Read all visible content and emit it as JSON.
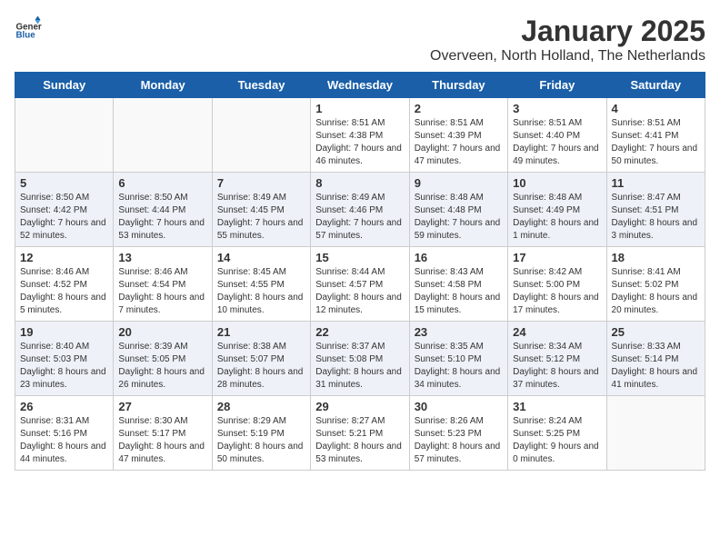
{
  "header": {
    "logo_general": "General",
    "logo_blue": "Blue",
    "month_title": "January 2025",
    "location": "Overveen, North Holland, The Netherlands"
  },
  "weekdays": [
    "Sunday",
    "Monday",
    "Tuesday",
    "Wednesday",
    "Thursday",
    "Friday",
    "Saturday"
  ],
  "rows": [
    [
      {
        "day": "",
        "info": ""
      },
      {
        "day": "",
        "info": ""
      },
      {
        "day": "",
        "info": ""
      },
      {
        "day": "1",
        "info": "Sunrise: 8:51 AM\nSunset: 4:38 PM\nDaylight: 7 hours and 46 minutes."
      },
      {
        "day": "2",
        "info": "Sunrise: 8:51 AM\nSunset: 4:39 PM\nDaylight: 7 hours and 47 minutes."
      },
      {
        "day": "3",
        "info": "Sunrise: 8:51 AM\nSunset: 4:40 PM\nDaylight: 7 hours and 49 minutes."
      },
      {
        "day": "4",
        "info": "Sunrise: 8:51 AM\nSunset: 4:41 PM\nDaylight: 7 hours and 50 minutes."
      }
    ],
    [
      {
        "day": "5",
        "info": "Sunrise: 8:50 AM\nSunset: 4:42 PM\nDaylight: 7 hours and 52 minutes."
      },
      {
        "day": "6",
        "info": "Sunrise: 8:50 AM\nSunset: 4:44 PM\nDaylight: 7 hours and 53 minutes."
      },
      {
        "day": "7",
        "info": "Sunrise: 8:49 AM\nSunset: 4:45 PM\nDaylight: 7 hours and 55 minutes."
      },
      {
        "day": "8",
        "info": "Sunrise: 8:49 AM\nSunset: 4:46 PM\nDaylight: 7 hours and 57 minutes."
      },
      {
        "day": "9",
        "info": "Sunrise: 8:48 AM\nSunset: 4:48 PM\nDaylight: 7 hours and 59 minutes."
      },
      {
        "day": "10",
        "info": "Sunrise: 8:48 AM\nSunset: 4:49 PM\nDaylight: 8 hours and 1 minute."
      },
      {
        "day": "11",
        "info": "Sunrise: 8:47 AM\nSunset: 4:51 PM\nDaylight: 8 hours and 3 minutes."
      }
    ],
    [
      {
        "day": "12",
        "info": "Sunrise: 8:46 AM\nSunset: 4:52 PM\nDaylight: 8 hours and 5 minutes."
      },
      {
        "day": "13",
        "info": "Sunrise: 8:46 AM\nSunset: 4:54 PM\nDaylight: 8 hours and 7 minutes."
      },
      {
        "day": "14",
        "info": "Sunrise: 8:45 AM\nSunset: 4:55 PM\nDaylight: 8 hours and 10 minutes."
      },
      {
        "day": "15",
        "info": "Sunrise: 8:44 AM\nSunset: 4:57 PM\nDaylight: 8 hours and 12 minutes."
      },
      {
        "day": "16",
        "info": "Sunrise: 8:43 AM\nSunset: 4:58 PM\nDaylight: 8 hours and 15 minutes."
      },
      {
        "day": "17",
        "info": "Sunrise: 8:42 AM\nSunset: 5:00 PM\nDaylight: 8 hours and 17 minutes."
      },
      {
        "day": "18",
        "info": "Sunrise: 8:41 AM\nSunset: 5:02 PM\nDaylight: 8 hours and 20 minutes."
      }
    ],
    [
      {
        "day": "19",
        "info": "Sunrise: 8:40 AM\nSunset: 5:03 PM\nDaylight: 8 hours and 23 minutes."
      },
      {
        "day": "20",
        "info": "Sunrise: 8:39 AM\nSunset: 5:05 PM\nDaylight: 8 hours and 26 minutes."
      },
      {
        "day": "21",
        "info": "Sunrise: 8:38 AM\nSunset: 5:07 PM\nDaylight: 8 hours and 28 minutes."
      },
      {
        "day": "22",
        "info": "Sunrise: 8:37 AM\nSunset: 5:08 PM\nDaylight: 8 hours and 31 minutes."
      },
      {
        "day": "23",
        "info": "Sunrise: 8:35 AM\nSunset: 5:10 PM\nDaylight: 8 hours and 34 minutes."
      },
      {
        "day": "24",
        "info": "Sunrise: 8:34 AM\nSunset: 5:12 PM\nDaylight: 8 hours and 37 minutes."
      },
      {
        "day": "25",
        "info": "Sunrise: 8:33 AM\nSunset: 5:14 PM\nDaylight: 8 hours and 41 minutes."
      }
    ],
    [
      {
        "day": "26",
        "info": "Sunrise: 8:31 AM\nSunset: 5:16 PM\nDaylight: 8 hours and 44 minutes."
      },
      {
        "day": "27",
        "info": "Sunrise: 8:30 AM\nSunset: 5:17 PM\nDaylight: 8 hours and 47 minutes."
      },
      {
        "day": "28",
        "info": "Sunrise: 8:29 AM\nSunset: 5:19 PM\nDaylight: 8 hours and 50 minutes."
      },
      {
        "day": "29",
        "info": "Sunrise: 8:27 AM\nSunset: 5:21 PM\nDaylight: 8 hours and 53 minutes."
      },
      {
        "day": "30",
        "info": "Sunrise: 8:26 AM\nSunset: 5:23 PM\nDaylight: 8 hours and 57 minutes."
      },
      {
        "day": "31",
        "info": "Sunrise: 8:24 AM\nSunset: 5:25 PM\nDaylight: 9 hours and 0 minutes."
      },
      {
        "day": "",
        "info": ""
      }
    ]
  ]
}
